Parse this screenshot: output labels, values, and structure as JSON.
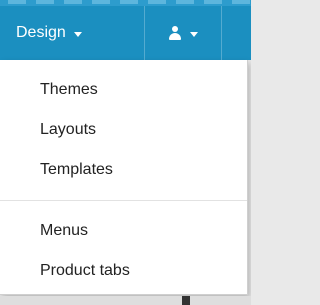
{
  "header": {
    "design_label": "Design",
    "design_caret": "chevron-down-icon",
    "user_icon": "user-icon",
    "user_caret": "chevron-down-icon"
  },
  "dropdown": {
    "group1": [
      {
        "label": "Themes"
      },
      {
        "label": "Layouts"
      },
      {
        "label": "Templates"
      }
    ],
    "group2": [
      {
        "label": "Menus"
      },
      {
        "label": "Product tabs"
      }
    ]
  },
  "colors": {
    "header_bg": "#1b8fc0",
    "menu_bg": "#ffffff",
    "menu_text": "#222222",
    "divider": "#e2e2e2"
  }
}
